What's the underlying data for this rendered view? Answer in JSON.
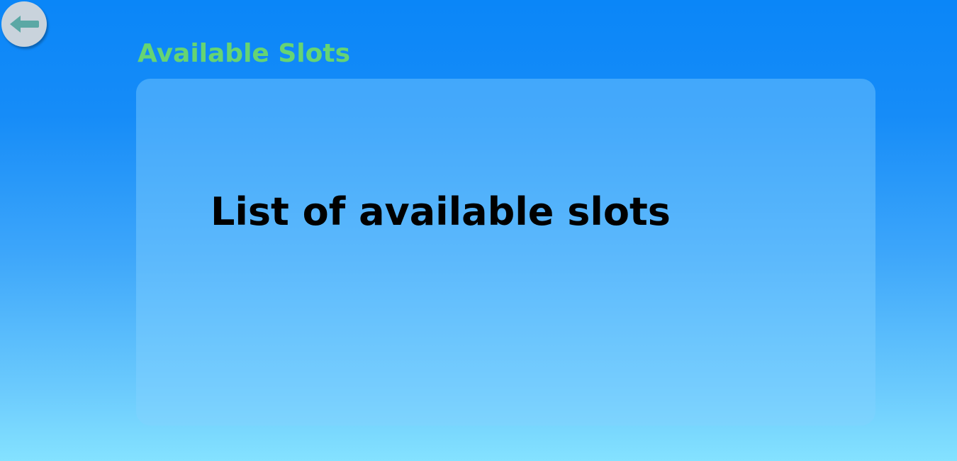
{
  "header": {
    "back_icon": "arrow-left-icon",
    "title": "Available Slots"
  },
  "card": {
    "heading": "List of available slots"
  },
  "colors": {
    "background_top": "#0a86f8",
    "background_bottom": "#84e2ff",
    "title": "#66d473",
    "back_button": "#c9d3dc",
    "back_arrow": "#5ba8a5",
    "heading": "#000000"
  }
}
